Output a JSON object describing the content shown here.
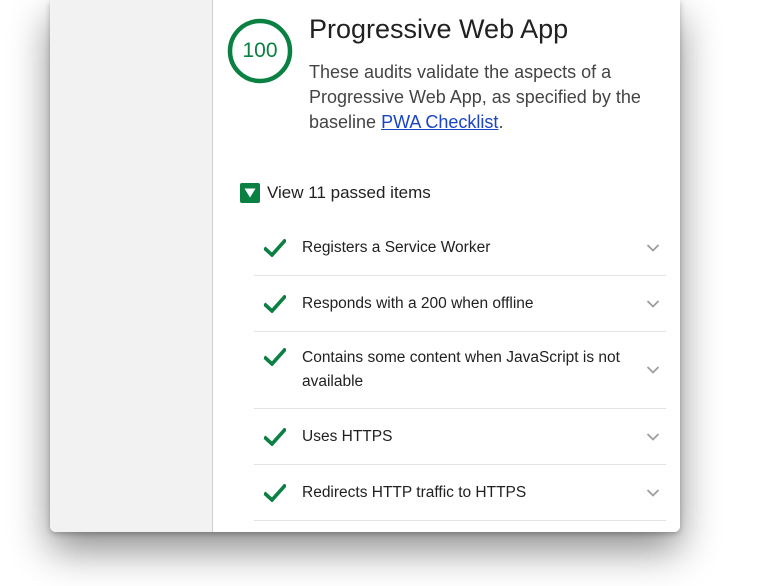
{
  "category": {
    "score": "100",
    "title": "Progressive Web App",
    "description_prefix": "These audits validate the aspects of a Progressive Web App, as specified by the baseline ",
    "description_link": "PWA Checklist",
    "description_suffix": ".",
    "score_color": "#0b8043"
  },
  "passed": {
    "label": "View 11 passed items",
    "expanded": true
  },
  "audits": [
    {
      "label": "Registers a Service Worker",
      "status": "pass",
      "icon": "check-icon"
    },
    {
      "label": "Responds with a 200 when offline",
      "status": "pass",
      "icon": "check-icon"
    },
    {
      "label": "Contains some content when JavaScript is not available",
      "status": "pass",
      "icon": "check-icon"
    },
    {
      "label": "Uses HTTPS",
      "status": "pass",
      "icon": "check-icon"
    },
    {
      "label": "Redirects HTTP traffic to HTTPS",
      "status": "pass",
      "icon": "check-icon"
    }
  ],
  "colors": {
    "pass": "#0b8043",
    "link": "#1a45c8",
    "sidebar": "#f2f2f2"
  }
}
